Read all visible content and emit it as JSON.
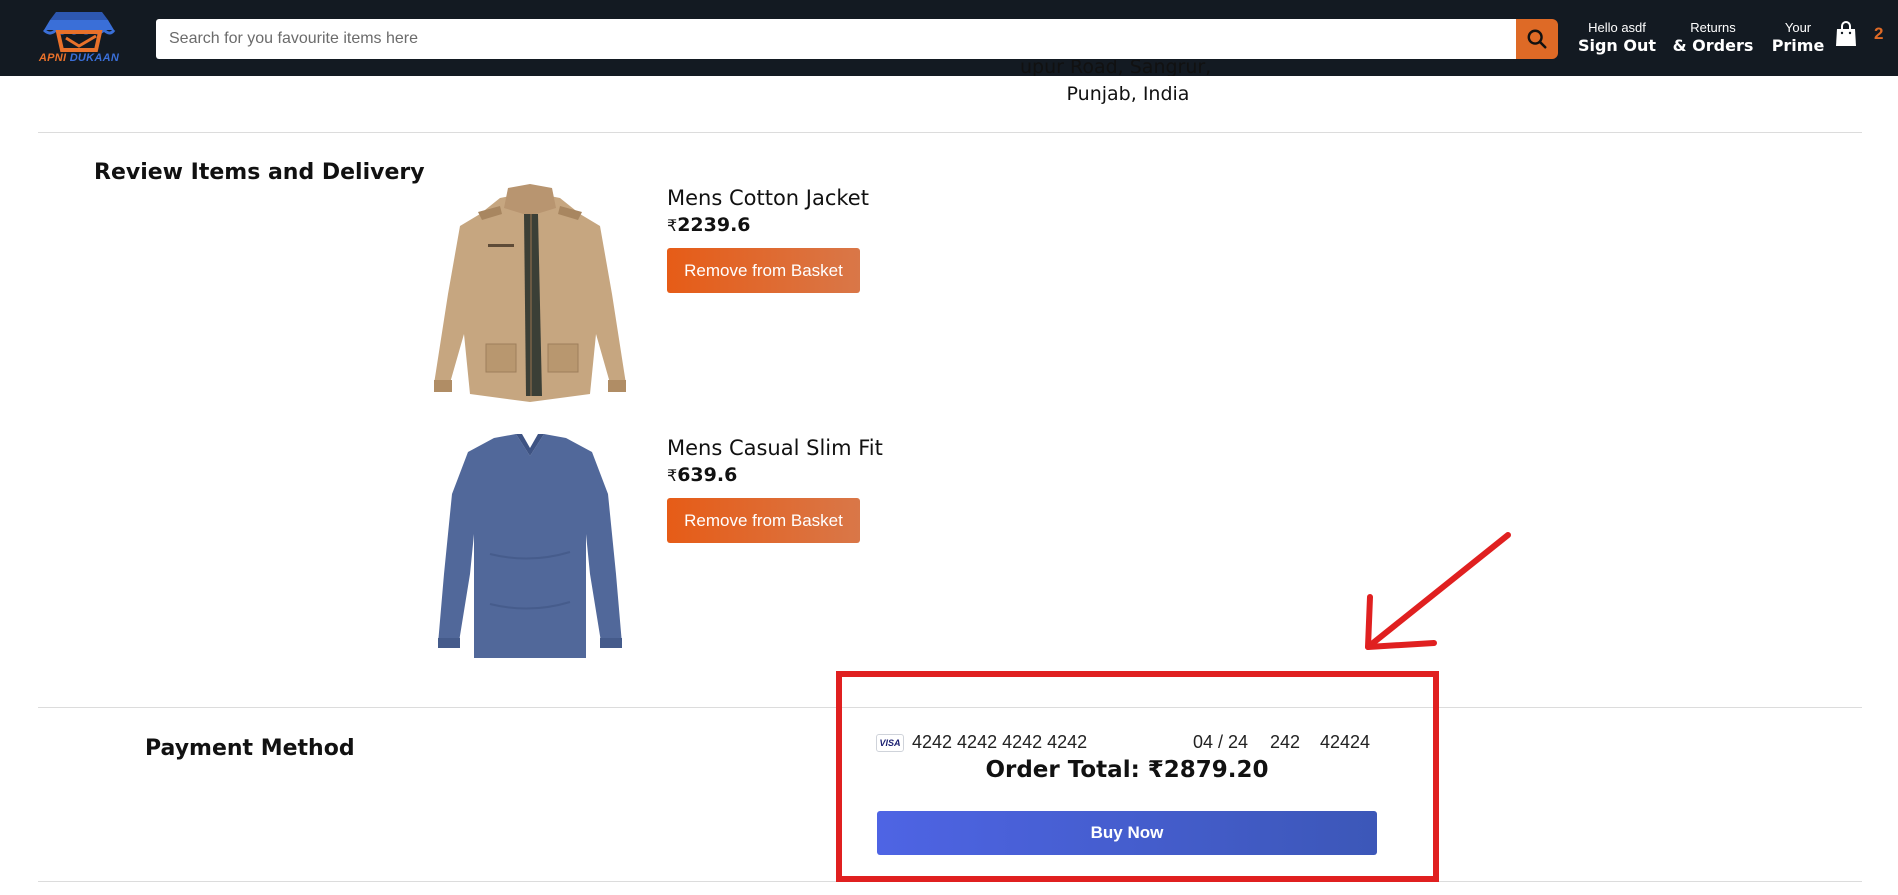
{
  "header": {
    "logo_text_part1": "APNI",
    "logo_text_part2": "DUKAAN",
    "search_placeholder": "Search for you favourite items here",
    "nav": [
      {
        "line1": "Hello asdf",
        "line2": "Sign Out"
      },
      {
        "line1": "Returns",
        "line2": "& Orders"
      },
      {
        "line1": "Your",
        "line2": "Prime"
      }
    ],
    "basket_count": "2"
  },
  "address": {
    "partial_line": "upur Road, Sangrur,",
    "state_line": "Punjab, India"
  },
  "review": {
    "title": "Review Items and Delivery",
    "items": [
      {
        "title": "Mens Cotton Jacket",
        "currency": "₹",
        "price": "2239.6",
        "remove_label": "Remove from Basket",
        "image": "jacket-image"
      },
      {
        "title": "Mens Casual Slim Fit",
        "currency": "₹",
        "price": "639.6",
        "remove_label": "Remove from Basket",
        "image": "sweater-image"
      }
    ]
  },
  "payment": {
    "title": "Payment Method",
    "card_brand": "VISA",
    "card_number": "4242 4242 4242 4242",
    "expiry": "04 / 24",
    "cvc": "242",
    "zip": "42424",
    "order_total": "Order Total: ₹2879.20",
    "buy_label": "Buy Now"
  },
  "colors": {
    "header_bg": "#131a22",
    "accent_orange": "#de6a26",
    "buy_button": "#4e64e4",
    "annotation_red": "#e02020"
  }
}
